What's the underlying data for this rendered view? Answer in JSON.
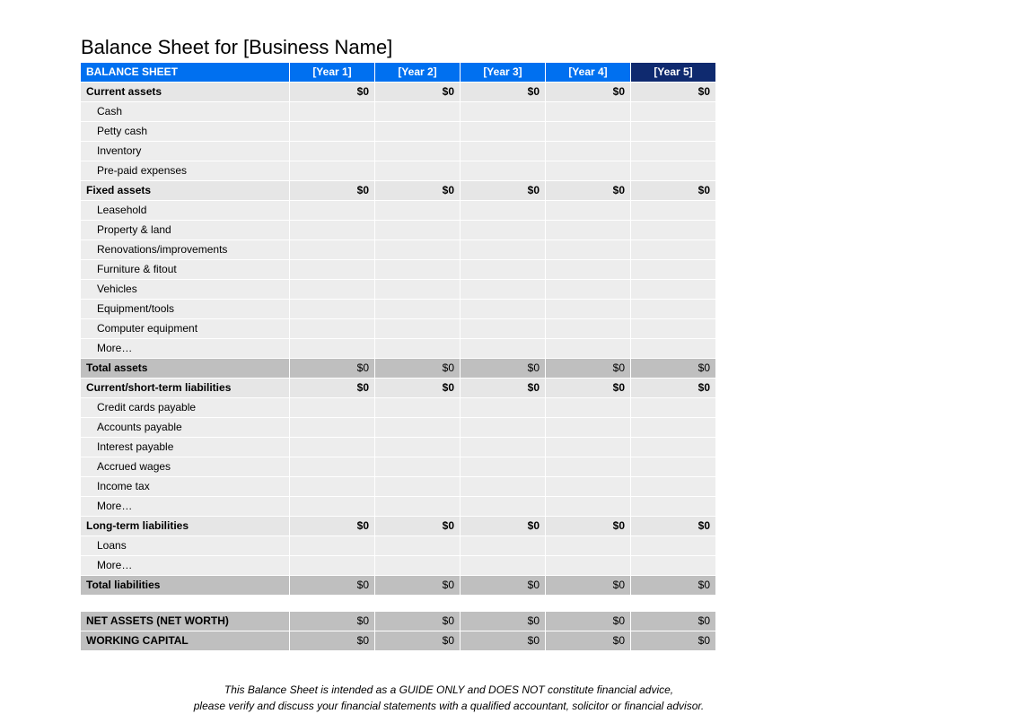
{
  "title": "Balance Sheet for [Business Name]",
  "header": {
    "label": "BALANCE SHEET",
    "years": [
      "[Year 1]",
      "[Year 2]",
      "[Year 3]",
      "[Year 4]",
      "[Year 5]"
    ]
  },
  "sections": [
    {
      "label": "Current assets",
      "values": [
        "$0",
        "$0",
        "$0",
        "$0",
        "$0"
      ],
      "items": [
        {
          "label": "Cash",
          "values": [
            "",
            "",
            "",
            "",
            ""
          ]
        },
        {
          "label": "Petty cash",
          "values": [
            "",
            "",
            "",
            "",
            ""
          ]
        },
        {
          "label": "Inventory",
          "values": [
            "",
            "",
            "",
            "",
            ""
          ]
        },
        {
          "label": "Pre-paid expenses",
          "values": [
            "",
            "",
            "",
            "",
            ""
          ]
        }
      ]
    },
    {
      "label": "Fixed assets",
      "values": [
        "$0",
        "$0",
        "$0",
        "$0",
        "$0"
      ],
      "items": [
        {
          "label": "Leasehold",
          "values": [
            "",
            "",
            "",
            "",
            ""
          ]
        },
        {
          "label": "Property & land",
          "values": [
            "",
            "",
            "",
            "",
            ""
          ]
        },
        {
          "label": "Renovations/improvements",
          "values": [
            "",
            "",
            "",
            "",
            ""
          ]
        },
        {
          "label": "Furniture & fitout",
          "values": [
            "",
            "",
            "",
            "",
            ""
          ]
        },
        {
          "label": "Vehicles",
          "values": [
            "",
            "",
            "",
            "",
            ""
          ]
        },
        {
          "label": "Equipment/tools",
          "values": [
            "",
            "",
            "",
            "",
            ""
          ]
        },
        {
          "label": "Computer equipment",
          "values": [
            "",
            "",
            "",
            "",
            ""
          ]
        },
        {
          "label": "More…",
          "values": [
            "",
            "",
            "",
            "",
            ""
          ]
        }
      ]
    }
  ],
  "total_assets": {
    "label": "Total assets",
    "values": [
      "$0",
      "$0",
      "$0",
      "$0",
      "$0"
    ]
  },
  "liab_sections": [
    {
      "label": "Current/short-term liabilities",
      "values": [
        "$0",
        "$0",
        "$0",
        "$0",
        "$0"
      ],
      "items": [
        {
          "label": "Credit cards payable",
          "values": [
            "",
            "",
            "",
            "",
            ""
          ]
        },
        {
          "label": "Accounts payable",
          "values": [
            "",
            "",
            "",
            "",
            ""
          ]
        },
        {
          "label": "Interest payable",
          "values": [
            "",
            "",
            "",
            "",
            ""
          ]
        },
        {
          "label": "Accrued wages",
          "values": [
            "",
            "",
            "",
            "",
            ""
          ]
        },
        {
          "label": "Income tax",
          "values": [
            "",
            "",
            "",
            "",
            ""
          ]
        },
        {
          "label": "More…",
          "values": [
            "",
            "",
            "",
            "",
            ""
          ]
        }
      ]
    },
    {
      "label": "Long-term liabilities",
      "values": [
        "$0",
        "$0",
        "$0",
        "$0",
        "$0"
      ],
      "items": [
        {
          "label": "Loans",
          "values": [
            "",
            "",
            "",
            "",
            ""
          ]
        },
        {
          "label": "More…",
          "values": [
            "",
            "",
            "",
            "",
            ""
          ]
        }
      ]
    }
  ],
  "total_liabilities": {
    "label": "Total liabilities",
    "values": [
      "$0",
      "$0",
      "$0",
      "$0",
      "$0"
    ]
  },
  "net_assets": {
    "label": "NET ASSETS (NET WORTH)",
    "values": [
      "$0",
      "$0",
      "$0",
      "$0",
      "$0"
    ]
  },
  "working_capital": {
    "label": "WORKING CAPITAL",
    "values": [
      "$0",
      "$0",
      "$0",
      "$0",
      "$0"
    ]
  },
  "disclaimer": {
    "line1": "This Balance Sheet is intended as a GUIDE ONLY and DOES NOT constitute financial advice,",
    "line2": "please verify and discuss your financial statements with a qualified accountant, solicitor or financial advisor."
  }
}
